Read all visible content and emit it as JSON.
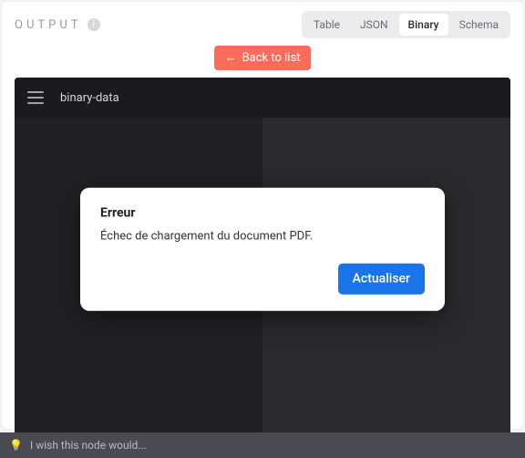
{
  "header": {
    "label": "OUTPUT",
    "info_icon_glyph": "i"
  },
  "tabs": {
    "table": "Table",
    "json": "JSON",
    "binary": "Binary",
    "schema": "Schema",
    "active": "binary"
  },
  "back_button": {
    "arrow_glyph": "←",
    "label": "Back to list"
  },
  "viewer": {
    "title": "binary-data"
  },
  "error_dialog": {
    "title": "Erreur",
    "message": "Échec de chargement du document PDF.",
    "action_label": "Actualiser"
  },
  "footer": {
    "bulb_glyph": "💡",
    "placeholder": "I wish this node would..."
  }
}
